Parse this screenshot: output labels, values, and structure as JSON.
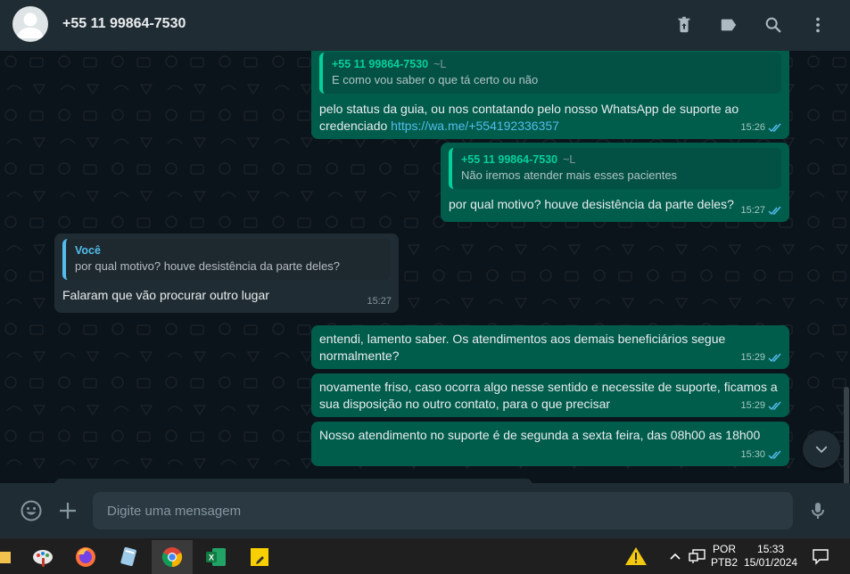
{
  "header": {
    "contact_name": "+55 11 99864-7530",
    "icons": [
      "delete-icon",
      "label-icon",
      "search-icon",
      "menu-icon"
    ]
  },
  "messages": [
    {
      "direction": "outgoing",
      "quote_author": "+55 11 99864-7530",
      "quote_alias": "~L",
      "quote_text": "E como vou saber o que tá certo ou não",
      "text_before_link": "pelo status da guia, ou nos contatando pelo nosso WhatsApp de suporte ao credenciado ",
      "link": "https://wa.me/+554192336357",
      "time": "15:26",
      "status": "read"
    },
    {
      "direction": "outgoing",
      "quote_author": "+55 11 99864-7530",
      "quote_alias": "~L",
      "quote_text": "Não iremos atender mais esses pacientes",
      "text": "por qual motivo? houve desistência da parte deles?",
      "time": "15:27",
      "status": "read"
    },
    {
      "direction": "incoming",
      "quote_author": "Você",
      "quote_text": "por qual motivo? houve desistência da parte deles?",
      "text": "Falaram que vão procurar outro lugar",
      "time": "15:27"
    },
    {
      "direction": "outgoing",
      "text": "entendi, lamento saber. Os atendimentos aos demais beneficiários segue normalmente?",
      "time": "15:29",
      "status": "read"
    },
    {
      "direction": "outgoing",
      "text": "novamente friso, caso ocorra algo nesse sentido e necessite de suporte, ficamos a sua disposição no outro contato, para o que precisar",
      "time": "15:29",
      "status": "read"
    },
    {
      "direction": "outgoing",
      "text": "Nosso atendimento no suporte é de segunda a sexta feira, das 08h00 as 18h00",
      "time": "15:30",
      "status": "read"
    }
  ],
  "composer": {
    "placeholder": "Digite uma mensagem",
    "icons": [
      "emoji-icon",
      "attach-plus-icon",
      "microphone-icon"
    ]
  },
  "taskbar": {
    "apps": [
      "paint-app-icon",
      "firefox-icon",
      "notepad-app-icon",
      "chrome-icon",
      "excel-icon",
      "sticky-notes-icon"
    ],
    "active_app": "chrome-icon",
    "language_top": "POR",
    "language_bottom": "PTB2",
    "time": "15:33",
    "date": "15/01/2024"
  },
  "colors": {
    "outgoing_bubble": "#005c4b",
    "incoming_bubble": "#202c33",
    "header_bg": "#202c33",
    "chat_bg": "#0b141a",
    "accent_green": "#06cf9c",
    "read_ticks": "#53bdeb"
  }
}
